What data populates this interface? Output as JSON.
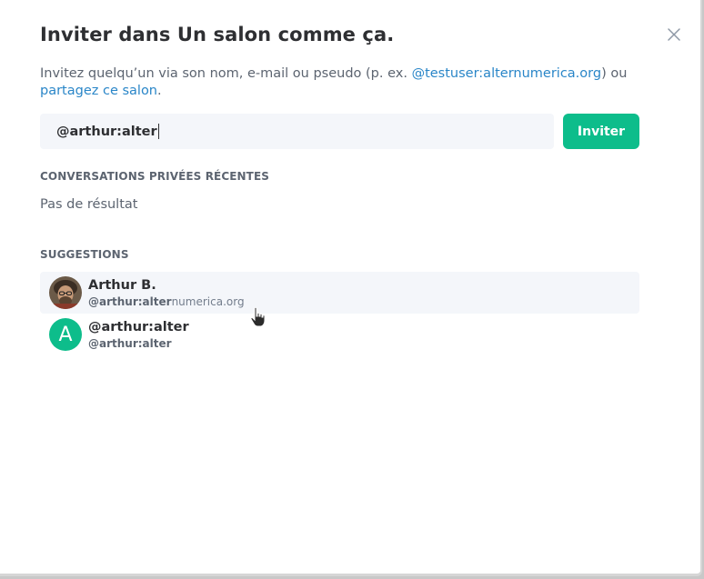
{
  "dialog": {
    "title": "Inviter dans Un salon comme ça.",
    "intro_text": "Invitez quelqu’un via son nom, e-mail ou pseudo (p. ex. ",
    "intro_example_link": "@testuser:alternumerica.org",
    "intro_or": ") ou",
    "intro_share_link": "partagez ce salon",
    "intro_end": "."
  },
  "search": {
    "value": "@arthur:alter"
  },
  "invite_button": {
    "label": "Inviter"
  },
  "recent": {
    "heading": "CONVERSATIONS PRIVÉES RÉCENTES",
    "empty_text": "Pas de résultat"
  },
  "suggestions": {
    "heading": "SUGGESTIONS",
    "items": [
      {
        "name": "Arthur B.",
        "id_match": "@arthur:alter",
        "id_rest": "numerica.org",
        "avatar": "photo"
      },
      {
        "name": "@arthur:alter",
        "id_match": "@arthur:alter",
        "id_rest": "",
        "avatar_letter": "A"
      }
    ]
  },
  "colors": {
    "accent": "#0dbd8b",
    "link": "#2a86c8",
    "text": "#2e2f32",
    "muted": "#5c6470"
  }
}
